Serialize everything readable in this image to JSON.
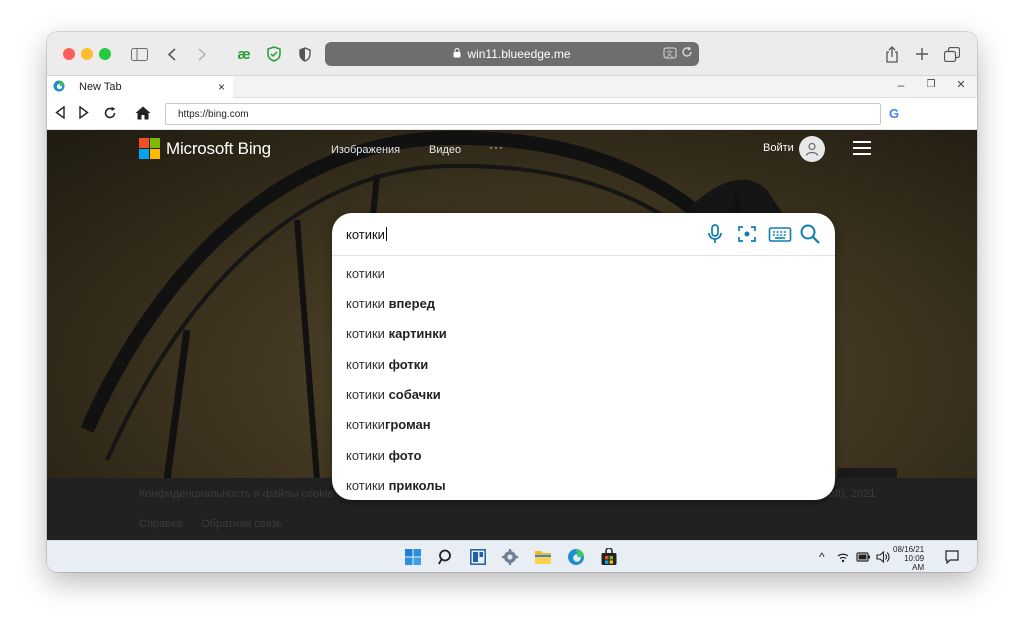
{
  "safari": {
    "address": "win11.blueedge.me",
    "icons": [
      "sidebar-icon",
      "back-icon",
      "forward-icon",
      "extension-ae-icon",
      "shield-check-icon",
      "privacy-shield-icon",
      "share-icon",
      "new-tab-icon",
      "tabs-overview-icon"
    ]
  },
  "tab": {
    "title": "New Tab",
    "close": "×"
  },
  "window_controls": {
    "minimize": "–",
    "restore": "❐",
    "close": "✕"
  },
  "nav": {
    "url": "https://bing.com"
  },
  "bing": {
    "logo_text": "Microsoft Bing",
    "nav": [
      "Изображения",
      "Видео",
      "···"
    ],
    "signin": "Войти",
    "search_value": "котики",
    "suggestions": [
      {
        "prefix": "котики",
        "bold": ""
      },
      {
        "prefix": "котики ",
        "bold": "вперед"
      },
      {
        "prefix": "котики ",
        "bold": "картинки"
      },
      {
        "prefix": "котики ",
        "bold": "фотки"
      },
      {
        "prefix": "котики ",
        "bold": "собачки"
      },
      {
        "prefix": "котики",
        "bold": "громан"
      },
      {
        "prefix": "котики ",
        "bold": "фото"
      },
      {
        "prefix": "котики ",
        "bold": "приколы"
      }
    ],
    "footer": {
      "privacy": "Конфиденциальность и файлы cookie",
      "copyright": "oft), 2021",
      "help": "Справка",
      "feedback": "Обратная связь"
    }
  },
  "colors": {
    "bing_blue": "#1a73c8",
    "accent_teal": "#0e7fa8"
  },
  "taskbar": {
    "icons": [
      "windows-start-icon",
      "search-icon",
      "task-view-icon",
      "settings-icon",
      "file-explorer-icon",
      "edge-icon",
      "store-icon"
    ],
    "tray_arrow": "^",
    "date": "08/16/21",
    "time": "10:09",
    "ampm": "AM"
  }
}
